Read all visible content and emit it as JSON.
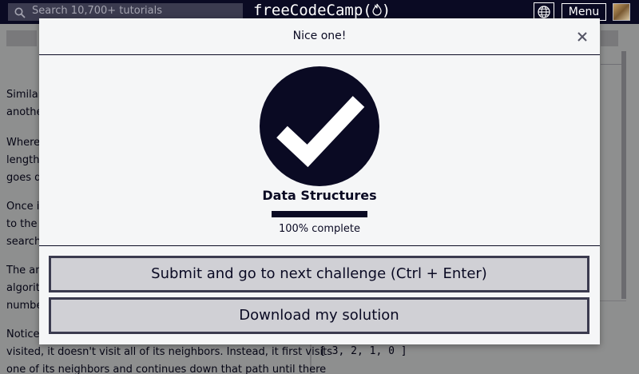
{
  "nav": {
    "search_placeholder": "Search 10,700+ tutorials",
    "logo_text": "freeCodeCamp(",
    "logo_flame": "🔥",
    "logo_close": ")",
    "menu_label": "Menu"
  },
  "background_page": {
    "paragraph_fragments": [
      "Similar",
      "anothe",
      "Where",
      "lengths",
      "goes do",
      "Once i",
      "to the",
      "search",
      "The an",
      "algorit",
      "numbe",
      "Notice",
      "visited, it doesn't visit all of its neighbors. Instead, it first visits",
      "one of its neighbors and continues down that path until there"
    ],
    "code_output": "[ 3, 2, 1, 0 ]"
  },
  "modal": {
    "title": "Nice one!",
    "close_symbol": "×",
    "certification": "Data Structures",
    "progress_percent": 100,
    "progress_text": "100% complete",
    "submit_label": "Submit and go to next challenge (Ctrl + Enter)",
    "download_label": "Download my solution"
  },
  "colors": {
    "primary_dark": "#0a0a23",
    "background_light": "#f5f6f7",
    "button_gray": "#d0d0d5",
    "button_border": "#3b3b4f"
  },
  "icons": [
    "search-icon",
    "globe-icon",
    "close-icon",
    "check-circle-icon"
  ]
}
